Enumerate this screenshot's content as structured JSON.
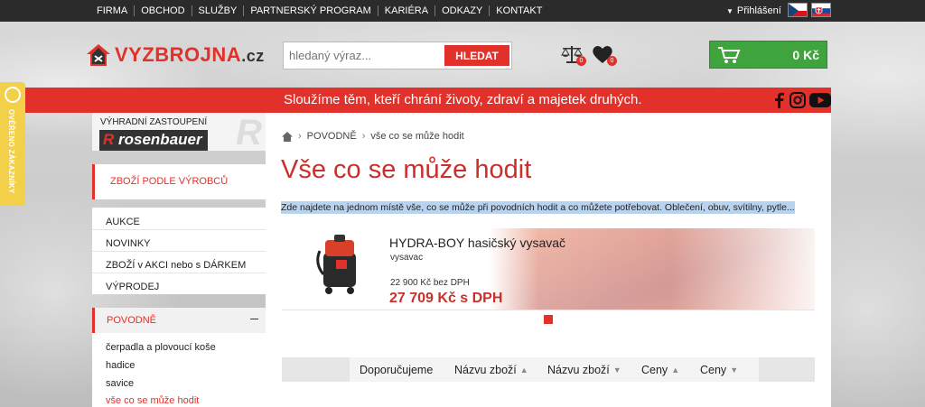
{
  "topbar": {
    "nav": [
      "FIRMA",
      "OBCHOD",
      "SLUŽBY",
      "PARTNERSKÝ PROGRAM",
      "KARIÉRA",
      "ODKAZY",
      "KONTAKT"
    ],
    "login": "Přihlášení",
    "flags": [
      "cz-flag",
      "sk-flag"
    ]
  },
  "header": {
    "logo_text": "VYZBROJNA",
    "logo_suffix": ".cz",
    "search_placeholder": "hledaný výraz...",
    "search_button": "HLEDAT",
    "compare_count": "0",
    "wishlist_count": "0",
    "cart_total": "0 Kč"
  },
  "slogan": "Sloužíme těm, kteří chrání životy, zdraví a majetek druhých.",
  "side_tab": "OVĚŘENO ZÁKAZNÍKY",
  "sidebar": {
    "rosenbauer_label": "VÝHRADNÍ ZASTOUPENÍ",
    "rosenbauer_brand": "rosenbauer",
    "by_products": "ZBOŽÍ PODLE VÝROBCŮ",
    "menu": [
      "AUKCE",
      "NOVINKY",
      "ZBOŽÍ v AKCI nebo s DÁRKEM",
      "VÝPRODEJ"
    ],
    "category": "POVODNĚ",
    "subcategories": [
      "čerpadla a plovoucí koše",
      "hadice",
      "savice",
      "vše co se může hodit"
    ]
  },
  "breadcrumb": [
    "POVODNĚ",
    "vše co se může hodit"
  ],
  "page_title": "Vše co se může hodit",
  "description": "Zde najdete na jednom místě vše, co se může při povodních hodit a co můžete potřebovat. Oblečení, obuv, svítilny, pytle...",
  "featured": {
    "name": "HYDRA-BOY hasičský vysavač",
    "category": "vysavac",
    "price_ex_vat": "22 900 Kč bez DPH",
    "price_vat": "27 709 Kč s DPH"
  },
  "sort": [
    {
      "label": "Doporučujeme",
      "arrow": ""
    },
    {
      "label": "Názvu zboží",
      "arrow": "▲"
    },
    {
      "label": "Názvu zboží",
      "arrow": "▼"
    },
    {
      "label": "Ceny",
      "arrow": "▲"
    },
    {
      "label": "Ceny",
      "arrow": "▼"
    }
  ],
  "colors": {
    "brand_red": "#e2312b",
    "cart_green": "#40a43e",
    "topbar": "#2b2b2b"
  }
}
